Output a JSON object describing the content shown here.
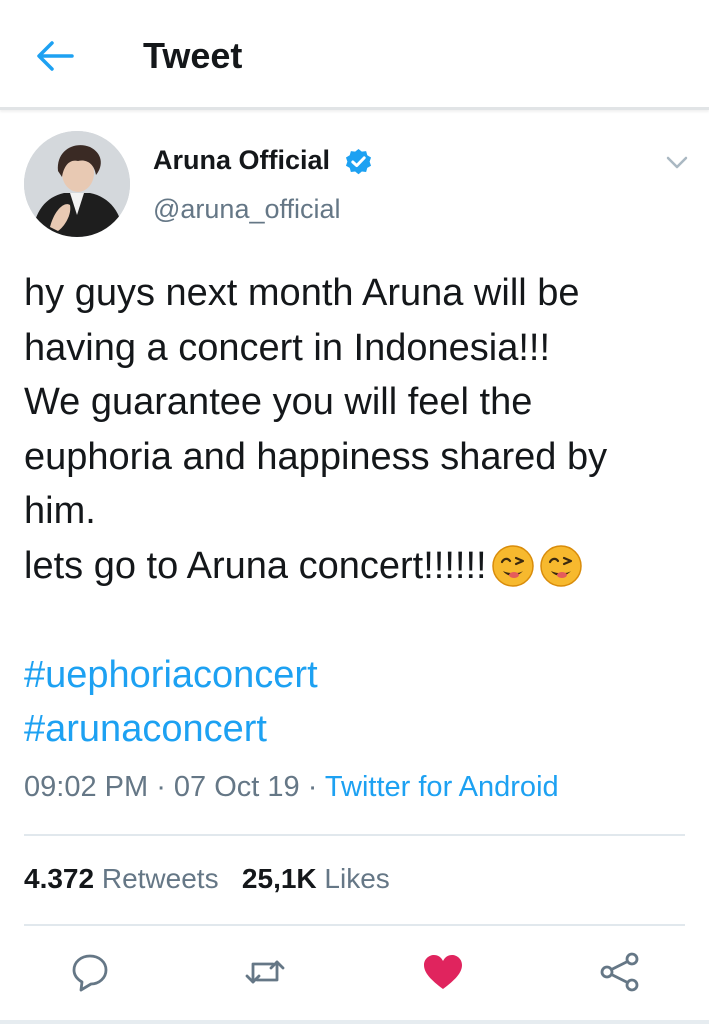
{
  "header": {
    "title": "Tweet",
    "back_icon": "arrow-left-icon"
  },
  "tweet": {
    "author": {
      "name": "Aruna Official",
      "handle": "@aruna_official",
      "verified": true
    },
    "text_lines": [
      "hy guys next month Aruna will be",
      "having a concert in Indonesia!!!",
      "We guarantee you will feel the",
      "euphoria and happiness shared by",
      "him.",
      "lets go to Aruna concert!!!!!!"
    ],
    "hashtags": [
      "#uephoriaconcert",
      "#arunaconcert"
    ],
    "meta": {
      "time": "09:02 PM",
      "sep1": " · ",
      "date": "07 Oct 19",
      "sep2": " · ",
      "source": "Twitter for Android"
    },
    "stats": {
      "retweets_count": "4.372",
      "retweets_label": "Retweets",
      "likes_count": "25,1K",
      "likes_label": "Likes"
    }
  },
  "colors": {
    "accent": "#1da1f2",
    "like": "#e0245e",
    "secondary": "#657786",
    "text": "#14171a"
  },
  "icons": [
    "arrow-left-icon",
    "verified-badge-icon",
    "chevron-down-icon",
    "wink-emoji-icon",
    "reply-icon",
    "retweet-icon",
    "heart-icon",
    "share-icon"
  ]
}
